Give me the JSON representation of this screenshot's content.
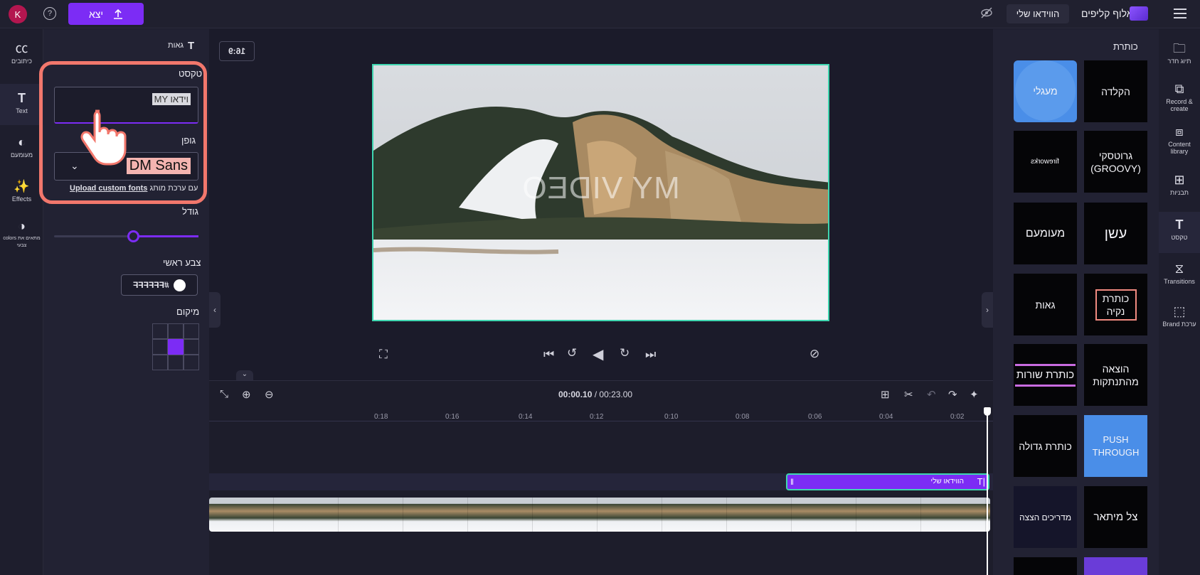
{
  "topbar": {
    "export_label": "יצא",
    "export_icon": "upload-icon",
    "avatar_letter": "K",
    "help_glyph": "?",
    "project_title": "הווידאו שלי",
    "brand_name": "אלוף קליפים"
  },
  "left_rail": {
    "items": [
      {
        "label": "כיתובים",
        "icon": "captions-icon"
      },
      {
        "label": "Text",
        "icon": "text-icon"
      },
      {
        "label": "מעומעם",
        "icon": "fade-icon"
      },
      {
        "label": "Effects",
        "icon": "effects-wand-icon"
      },
      {
        "label": "colors מתאים את צבעי",
        "icon": "color-adjust-icon"
      }
    ]
  },
  "properties": {
    "presets_label": "גאות",
    "text_section_label": "טקסט",
    "text_value": "MY וידאו",
    "font_section_label": "גופן",
    "font_value": "DM Sans",
    "upload_link": "Upload custom fonts",
    "upload_suffix": "עם ערכת מותג",
    "size_label": "גודל",
    "size_value": 0.5,
    "primary_color_label": "צבע ראשי",
    "primary_color_hex": "#FFFFFF",
    "position_label": "מיקום",
    "position_selected": "center"
  },
  "stage": {
    "aspect_ratio": "16:9",
    "overlay_text": "MY VIDEO"
  },
  "right_panel": {
    "title": "כותרת",
    "tiles": [
      {
        "label": "הקלדה",
        "bg": "#050507"
      },
      {
        "label": "מעגלי",
        "bg": "#050507"
      },
      {
        "label": "גרוטסקי (GROOVY)",
        "bg": "#050507"
      },
      {
        "label": "fireworks",
        "bg": "#050507"
      },
      {
        "label": "עשן",
        "bg": "#050507"
      },
      {
        "label": "מעומעם",
        "bg": "#050507"
      },
      {
        "label": "כותרת נקיה",
        "bg": "#050507"
      },
      {
        "label": "גאות",
        "bg": "#050507"
      },
      {
        "label": "הוצאה מהתנתקות",
        "bg": "#050507"
      },
      {
        "label": "כותרת שורות",
        "bg": "#050507"
      },
      {
        "label": "PUSH THROUGH",
        "bg": "#4a8ee8"
      },
      {
        "label": "כותרת גדולה",
        "bg": "#050507"
      },
      {
        "label": "צל מיתאר",
        "bg": "#050507"
      },
      {
        "label": "מדריכים הצצה",
        "bg": "#15152a"
      }
    ]
  },
  "right_rail": {
    "items": [
      {
        "label": "תיוג חדר",
        "icon": "folder-icon"
      },
      {
        "label": "Record & create",
        "icon": "camera-icon"
      },
      {
        "label": "Content library",
        "icon": "library-icon"
      },
      {
        "label": "תבניות",
        "icon": "templates-icon"
      },
      {
        "label": "טקסט",
        "icon": "text-icon"
      },
      {
        "label": "Transitions",
        "icon": "transitions-icon"
      },
      {
        "label": "Brand ערכת",
        "icon": "brand-kit-icon"
      }
    ]
  },
  "timeline": {
    "current_time": "00:00.10",
    "total_time": "00:23.00",
    "ticks": [
      "0:02",
      "0:04",
      "0:06",
      "0:08",
      "0:10",
      "0:12",
      "0:14",
      "0:16",
      "0:18"
    ],
    "text_clip_label": "הווידאו שלי"
  }
}
